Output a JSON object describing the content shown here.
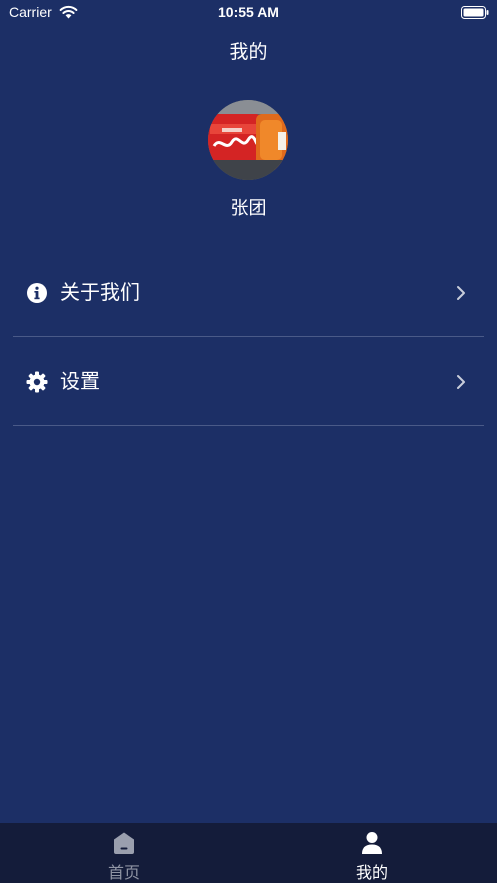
{
  "status_bar": {
    "carrier": "Carrier",
    "time": "10:55 AM"
  },
  "nav": {
    "title": "我的"
  },
  "profile": {
    "username": "张团"
  },
  "menu": {
    "items": [
      {
        "label": "关于我们",
        "icon": "info-icon"
      },
      {
        "label": "设置",
        "icon": "gear-icon"
      }
    ]
  },
  "tab_bar": {
    "tabs": [
      {
        "label": "首页",
        "icon": "home-icon",
        "selected": false
      },
      {
        "label": "我的",
        "icon": "person-icon",
        "selected": true
      }
    ]
  },
  "colors": {
    "background": "#1c2f66",
    "tab_bar_background": "#141c3a",
    "tab_inactive": "#8f94a4",
    "tab_active": "#ffffff",
    "divider": "#4a5a88"
  }
}
